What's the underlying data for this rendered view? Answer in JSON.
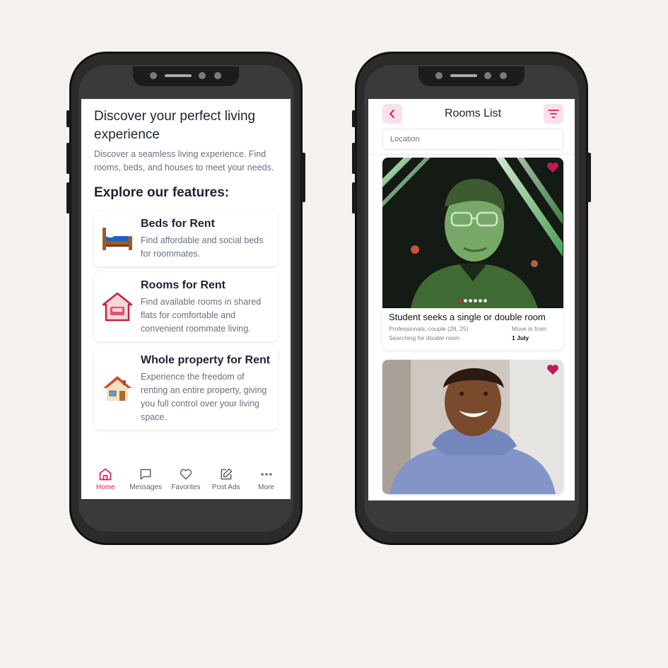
{
  "home": {
    "hero_title": "Discover your perfect living experience",
    "hero_desc": "Discover a seamless living experience. Find rooms, beds, and houses to meet your needs.",
    "features_title": "Explore our features:",
    "features": [
      {
        "title": "Beds for Rent",
        "desc": "Find affordable and social beds for roommates.",
        "icon": "bed-icon"
      },
      {
        "title": "Rooms for Rent",
        "desc": "Find available rooms in shared flats for comfortable and convenient roommate living.",
        "icon": "room-house-icon"
      },
      {
        "title": "Whole property for Rent",
        "desc": "Experience the freedom of renting an entire property, giving you full control over your living space.",
        "icon": "house-icon"
      }
    ],
    "nav": [
      {
        "label": "Home",
        "icon": "home-icon",
        "active": true
      },
      {
        "label": "Messages",
        "icon": "message-icon",
        "active": false
      },
      {
        "label": "Favorites",
        "icon": "heart-icon",
        "active": false
      },
      {
        "label": "Post Ads",
        "icon": "edit-icon",
        "active": false
      },
      {
        "label": "More",
        "icon": "more-icon",
        "active": false
      }
    ]
  },
  "rooms_list": {
    "title": "Rooms List",
    "back_icon": "chevron-left-icon",
    "filter_icon": "filter-icon",
    "location_placeholder": "Location",
    "listings": [
      {
        "title": "Student seeks a single or double room",
        "subtitle_1": "Professionals, couple (28, 25)",
        "subtitle_2": "Searching for double room",
        "move_in_label": "Move in from",
        "move_in_value": "1 July",
        "favorite": true
      },
      {
        "favorite": true
      }
    ]
  },
  "colors": {
    "accent": "#d81b60",
    "background": "#f5f2ed",
    "phone_frame": "#2b2b2b"
  }
}
